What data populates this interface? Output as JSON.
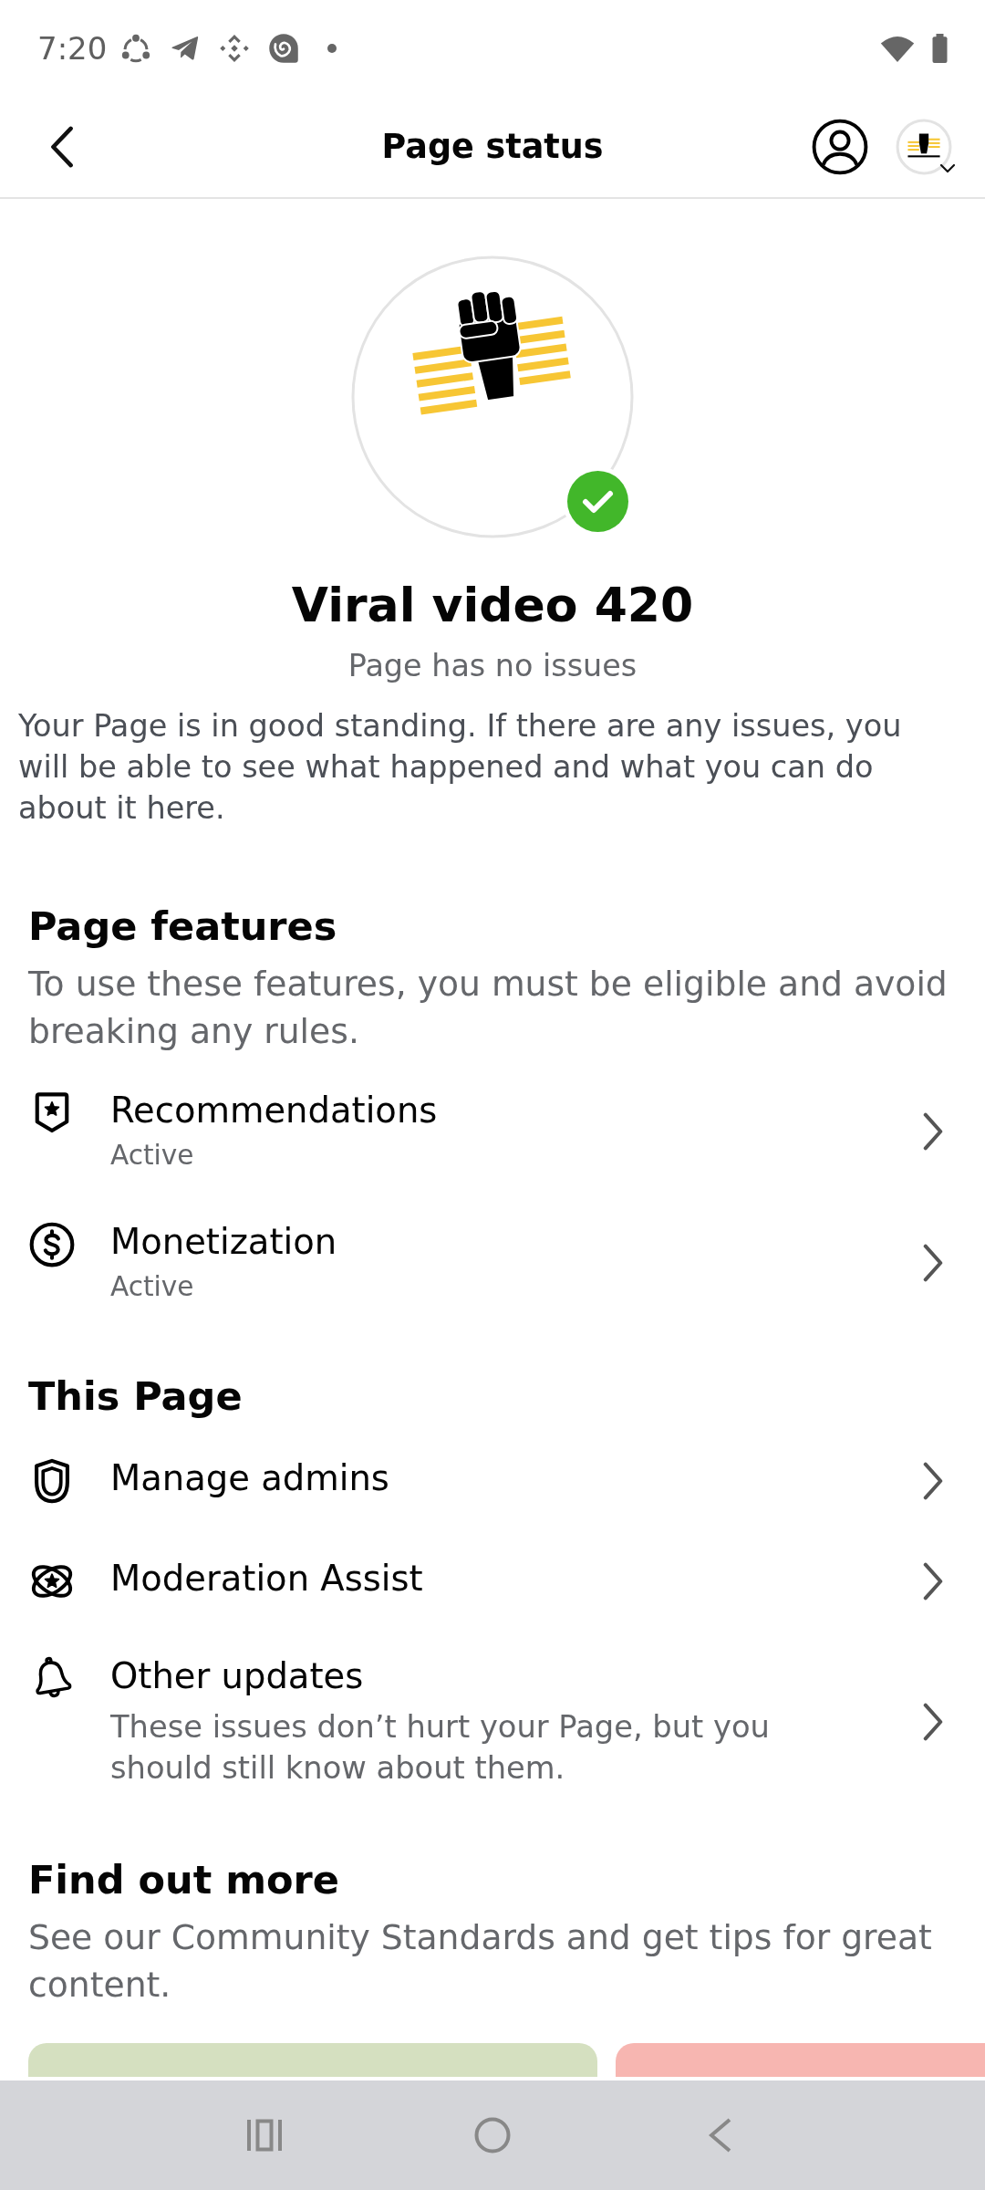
{
  "status_bar": {
    "time": "7:20"
  },
  "header": {
    "title": "Page status"
  },
  "page": {
    "name": "Viral video 420",
    "verified": true,
    "status": "Page has no issues",
    "description": "Your Page is in good standing. If there are any issues, you will be able to see what happened and what you can do about it here."
  },
  "sections": [
    {
      "title": "Page features",
      "description": "To use these features, you must be eligible and avoid breaking any rules.",
      "items": [
        {
          "title": "Recommendations",
          "subtitle": "Active"
        },
        {
          "title": "Monetization",
          "subtitle": "Active"
        }
      ]
    },
    {
      "title": "This Page",
      "items": [
        {
          "title": "Manage admins"
        },
        {
          "title": "Moderation Assist"
        },
        {
          "title": "Other updates",
          "description": "These issues don’t hurt your Page, but you should still know about them."
        }
      ]
    },
    {
      "title": "Find out more",
      "description": "See our Community Standards and get tips for great content.",
      "cards": [
        {
          "kind": "photo"
        },
        {
          "kind": "photo"
        }
      ]
    }
  ]
}
